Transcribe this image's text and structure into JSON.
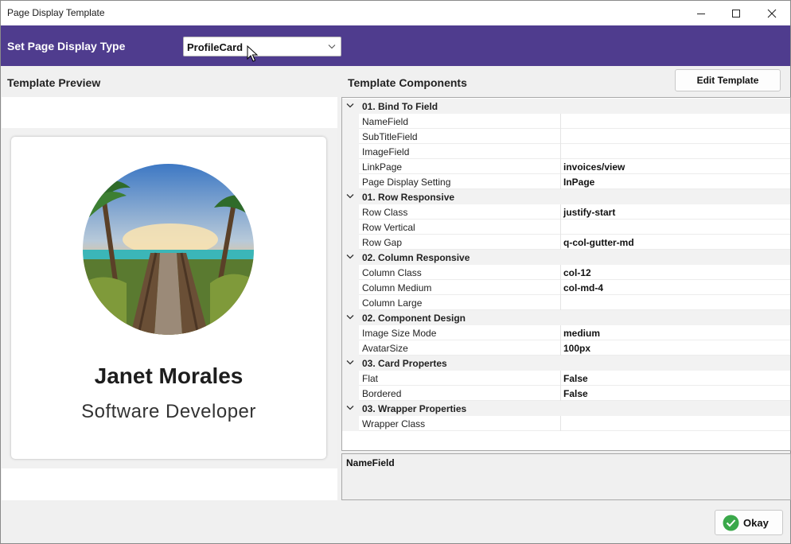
{
  "window": {
    "title": "Page Display Template"
  },
  "header": {
    "label": "Set Page Display Type",
    "select_value": "ProfileCard"
  },
  "preview": {
    "title": "Template Preview",
    "card": {
      "name": "Janet Morales",
      "subtitle": "Software Developer"
    }
  },
  "components": {
    "title": "Template Components",
    "edit_button": "Edit Template",
    "rows": [
      {
        "type": "category",
        "label": "01. Bind To Field"
      },
      {
        "type": "property",
        "name": "NameField",
        "value": ""
      },
      {
        "type": "property",
        "name": "SubTitleField",
        "value": ""
      },
      {
        "type": "property",
        "name": "ImageField",
        "value": ""
      },
      {
        "type": "property",
        "name": "LinkPage",
        "value": "invoices/view"
      },
      {
        "type": "property",
        "name": "Page Display Setting",
        "value": "InPage"
      },
      {
        "type": "category",
        "label": "01. Row Responsive"
      },
      {
        "type": "property",
        "name": "Row Class",
        "value": "justify-start"
      },
      {
        "type": "property",
        "name": "Row Vertical",
        "value": ""
      },
      {
        "type": "property",
        "name": "Row Gap",
        "value": "q-col-gutter-md"
      },
      {
        "type": "category",
        "label": "02. Column Responsive"
      },
      {
        "type": "property",
        "name": "Column Class",
        "value": "col-12"
      },
      {
        "type": "property",
        "name": "Column Medium",
        "value": "col-md-4"
      },
      {
        "type": "property",
        "name": "Column Large",
        "value": ""
      },
      {
        "type": "category",
        "label": "02. Component Design"
      },
      {
        "type": "property",
        "name": "Image Size Mode",
        "value": "medium"
      },
      {
        "type": "property",
        "name": "AvatarSize",
        "value": "100px"
      },
      {
        "type": "category",
        "label": "03. Card Propertes"
      },
      {
        "type": "property",
        "name": "Flat",
        "value": "False"
      },
      {
        "type": "property",
        "name": "Bordered",
        "value": "False"
      },
      {
        "type": "category",
        "label": "03. Wrapper Properties"
      },
      {
        "type": "property",
        "name": "Wrapper Class",
        "value": ""
      }
    ],
    "description_title": "NameField"
  },
  "footer": {
    "okay_label": "Okay"
  },
  "colors": {
    "header_bg": "#4f3c8e",
    "ok_green": "#3aa84a"
  },
  "icons": [
    "minimize-icon",
    "maximize-icon",
    "close-icon",
    "chevron-down-icon",
    "cursor-icon",
    "collapse-chevron-icon",
    "check-circle-icon"
  ]
}
